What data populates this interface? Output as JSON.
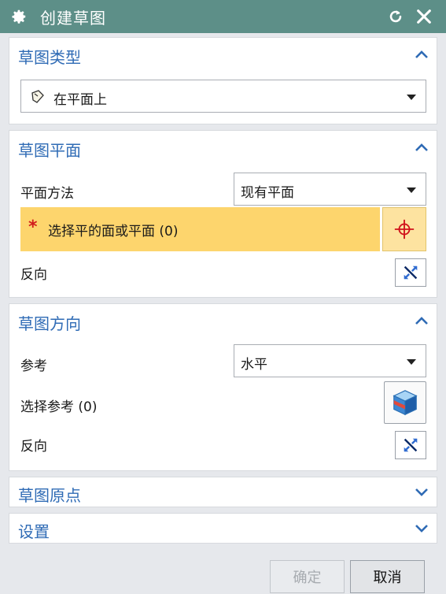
{
  "window": {
    "title": "创建草图"
  },
  "sections": {
    "type": {
      "title": "草图类型",
      "select_value": "在平面上"
    },
    "plane": {
      "title": "草图平面",
      "method_label": "平面方法",
      "method_value": "现有平面",
      "selection_marker": "*",
      "selection_label": "选择平的面或平面 (0)",
      "reverse_label": "反向"
    },
    "orientation": {
      "title": "草图方向",
      "reference_label": "参考",
      "reference_value": "水平",
      "select_ref_label": "选择参考 (0)",
      "reverse_label": "反向"
    },
    "origin": {
      "title": "草图原点"
    },
    "settings": {
      "title": "设置"
    }
  },
  "footer": {
    "ok_label": "确定",
    "cancel_label": "取消"
  },
  "colors": {
    "titlebar": "#5d8f88",
    "section_title": "#2f6bb5",
    "highlight": "#fdd56d",
    "required_star": "#d21c1c"
  }
}
